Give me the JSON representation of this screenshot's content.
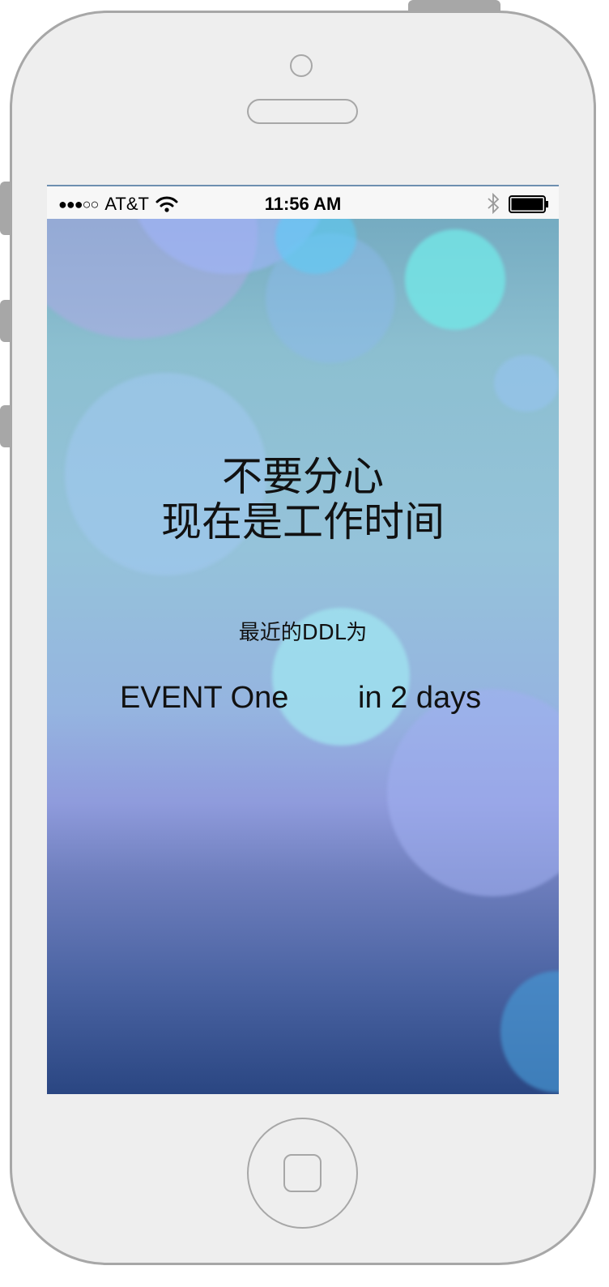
{
  "status_bar": {
    "signal": "●●●○○",
    "carrier": "AT&T",
    "time": "11:56 AM",
    "icons": [
      "wifi-icon",
      "bluetooth-icon",
      "battery-icon"
    ]
  },
  "main": {
    "headline_line1": "不要分心",
    "headline_line2": "现在是工作时间",
    "ddl_label": "最近的DDL为",
    "event_name": "EVENT One",
    "event_due": "in 2 days"
  },
  "colors": {
    "phone_body": "#eeeeee",
    "phone_outline": "#a7a7a7",
    "status_bar_bg": "#f7f7f7",
    "text": "#111111"
  }
}
